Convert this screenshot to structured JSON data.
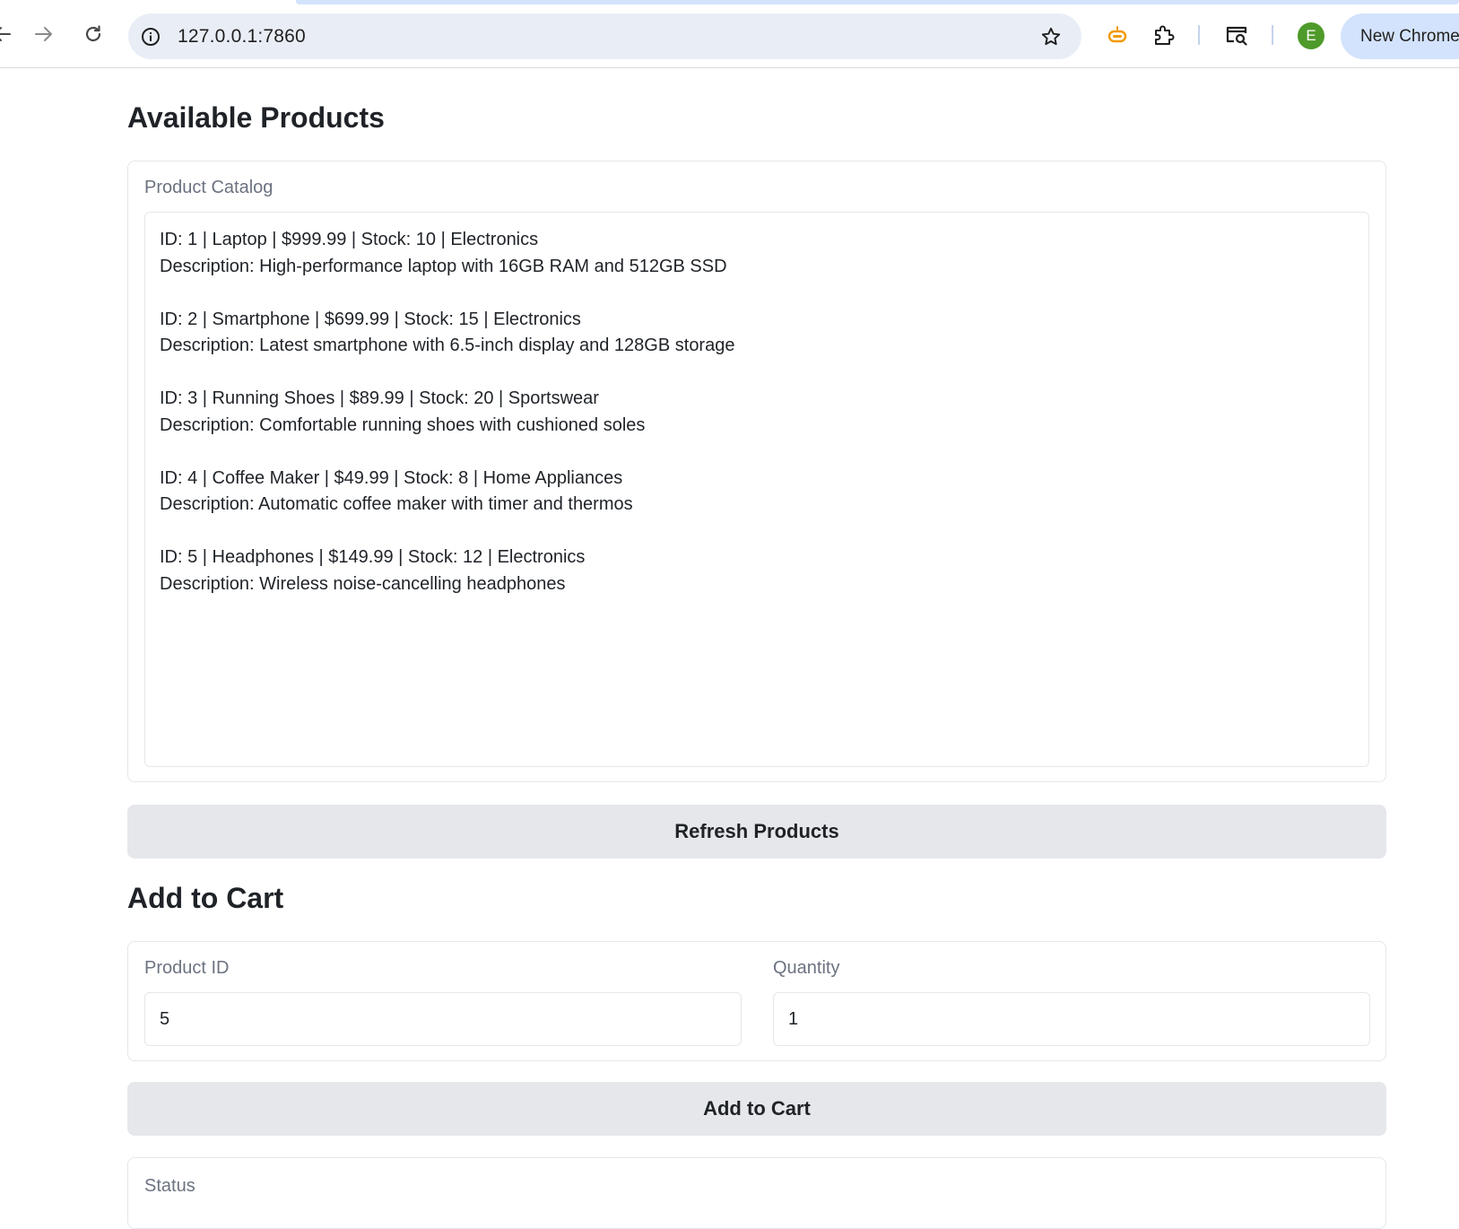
{
  "browser": {
    "url": "127.0.0.1:7860",
    "profile_initial": "E",
    "new_chrome_label": "New Chrome"
  },
  "products_section": {
    "title": "Available Products",
    "catalog_label": "Product Catalog",
    "products": [
      {
        "line1": "ID: 1 | Laptop | $999.99 | Stock: 10 | Electronics",
        "line2": "Description: High-performance laptop with 16GB RAM and 512GB SSD"
      },
      {
        "line1": "ID: 2 | Smartphone | $699.99 | Stock: 15 | Electronics",
        "line2": "Description: Latest smartphone with 6.5-inch display and 128GB storage"
      },
      {
        "line1": "ID: 3 | Running Shoes | $89.99 | Stock: 20 | Sportswear",
        "line2": "Description: Comfortable running shoes with cushioned soles"
      },
      {
        "line1": "ID: 4 | Coffee Maker | $49.99 | Stock: 8 | Home Appliances",
        "line2": "Description: Automatic coffee maker with timer and thermos"
      },
      {
        "line1": "ID: 5 | Headphones | $149.99 | Stock: 12 | Electronics",
        "line2": "Description: Wireless noise-cancelling headphones"
      }
    ],
    "refresh_label": "Refresh Products"
  },
  "cart_section": {
    "title": "Add to Cart",
    "product_id_label": "Product ID",
    "product_id_value": "5",
    "quantity_label": "Quantity",
    "quantity_value": "1",
    "add_label": "Add to Cart"
  },
  "status_section": {
    "label": "Status"
  },
  "icons": {
    "back": "back-arrow-icon",
    "forward": "forward-arrow-icon",
    "reload": "reload-icon",
    "site_info": "info-icon",
    "bookmark": "star-icon",
    "extension_orange": "robot-extension-icon",
    "extensions": "puzzle-icon",
    "tab_search": "tab-search-icon"
  },
  "colors": {
    "button_bg": "#e5e7eb",
    "border": "#e5e7eb",
    "label": "#6b7280",
    "omnibox": "#e9eef6",
    "avatar": "#4e9a2a",
    "pill": "#d3e3fd"
  }
}
